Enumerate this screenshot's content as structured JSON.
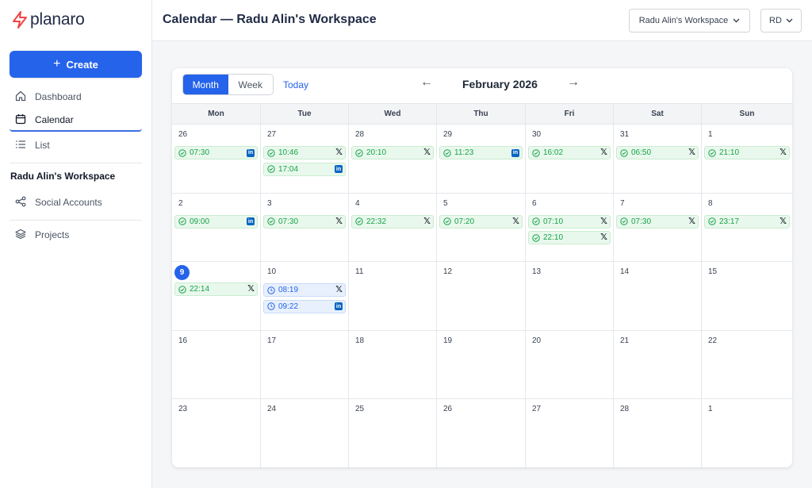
{
  "app": {
    "brand": "planaro",
    "colors": {
      "accent": "#2563eb",
      "published": "#16a34a",
      "linkedin": "#0a66c2",
      "brand_logo": "#ef4444"
    }
  },
  "sidebar": {
    "create_label": "Create",
    "nav": [
      {
        "label": "Dashboard",
        "icon": "home-icon",
        "active": false
      },
      {
        "label": "Calendar",
        "icon": "calendar-icon",
        "active": true
      },
      {
        "label": "List",
        "icon": "list-icon",
        "active": false
      }
    ],
    "workspace_heading": "Radu Alin's Workspace",
    "workspace_nav": [
      {
        "label": "Social Accounts",
        "icon": "share-icon"
      },
      {
        "label": "Projects",
        "icon": "layers-icon"
      }
    ]
  },
  "header": {
    "title": "Calendar — Radu Alin's Workspace",
    "workspace_select": "Radu Alin's Workspace",
    "user_initials": "RD"
  },
  "calendar": {
    "view_month": "Month",
    "view_week": "Week",
    "selected_view": "Month",
    "today_label": "Today",
    "prev_label": "←",
    "next_label": "→",
    "month_title": "February 2026",
    "weekdays": [
      "Mon",
      "Tue",
      "Wed",
      "Thu",
      "Fri",
      "Sat",
      "Sun"
    ],
    "weeks": [
      [
        {
          "day": "26",
          "events": [
            {
              "time": "07:30",
              "platform": "linkedin",
              "status": "published"
            }
          ]
        },
        {
          "day": "27",
          "events": [
            {
              "time": "10:46",
              "platform": "x",
              "status": "published"
            },
            {
              "time": "17:04",
              "platform": "linkedin",
              "status": "published"
            }
          ]
        },
        {
          "day": "28",
          "events": [
            {
              "time": "20:10",
              "platform": "x",
              "status": "published"
            }
          ]
        },
        {
          "day": "29",
          "events": [
            {
              "time": "11:23",
              "platform": "linkedin",
              "status": "published"
            }
          ]
        },
        {
          "day": "30",
          "events": [
            {
              "time": "16:02",
              "platform": "x",
              "status": "published"
            }
          ]
        },
        {
          "day": "31",
          "events": [
            {
              "time": "06:50",
              "platform": "x",
              "status": "published"
            }
          ]
        },
        {
          "day": "1",
          "events": [
            {
              "time": "21:10",
              "platform": "x",
              "status": "published"
            }
          ]
        }
      ],
      [
        {
          "day": "2",
          "events": [
            {
              "time": "09:00",
              "platform": "linkedin",
              "status": "published"
            }
          ]
        },
        {
          "day": "3",
          "events": [
            {
              "time": "07:30",
              "platform": "x",
              "status": "published"
            }
          ]
        },
        {
          "day": "4",
          "events": [
            {
              "time": "22:32",
              "platform": "x",
              "status": "published"
            }
          ]
        },
        {
          "day": "5",
          "events": [
            {
              "time": "07:20",
              "platform": "x",
              "status": "published"
            }
          ]
        },
        {
          "day": "6",
          "events": [
            {
              "time": "07:10",
              "platform": "x",
              "status": "published"
            },
            {
              "time": "22:10",
              "platform": "x",
              "status": "published"
            }
          ]
        },
        {
          "day": "7",
          "events": [
            {
              "time": "07:30",
              "platform": "x",
              "status": "published"
            }
          ]
        },
        {
          "day": "8",
          "events": [
            {
              "time": "23:17",
              "platform": "x",
              "status": "published"
            }
          ]
        }
      ],
      [
        {
          "day": "9",
          "today": true,
          "events": [
            {
              "time": "22:14",
              "platform": "x",
              "status": "published"
            }
          ]
        },
        {
          "day": "10",
          "events": [
            {
              "time": "08:19",
              "platform": "x",
              "status": "scheduled"
            },
            {
              "time": "09:22",
              "platform": "linkedin",
              "status": "scheduled"
            }
          ]
        },
        {
          "day": "11",
          "events": []
        },
        {
          "day": "12",
          "events": []
        },
        {
          "day": "13",
          "events": []
        },
        {
          "day": "14",
          "events": []
        },
        {
          "day": "15",
          "events": []
        }
      ],
      [
        {
          "day": "16",
          "events": []
        },
        {
          "day": "17",
          "events": []
        },
        {
          "day": "18",
          "events": []
        },
        {
          "day": "19",
          "events": []
        },
        {
          "day": "20",
          "events": []
        },
        {
          "day": "21",
          "events": []
        },
        {
          "day": "22",
          "events": []
        }
      ],
      [
        {
          "day": "23",
          "events": []
        },
        {
          "day": "24",
          "events": []
        },
        {
          "day": "25",
          "events": []
        },
        {
          "day": "26",
          "events": []
        },
        {
          "day": "27",
          "events": []
        },
        {
          "day": "28",
          "events": []
        },
        {
          "day": "1",
          "events": []
        }
      ]
    ]
  }
}
